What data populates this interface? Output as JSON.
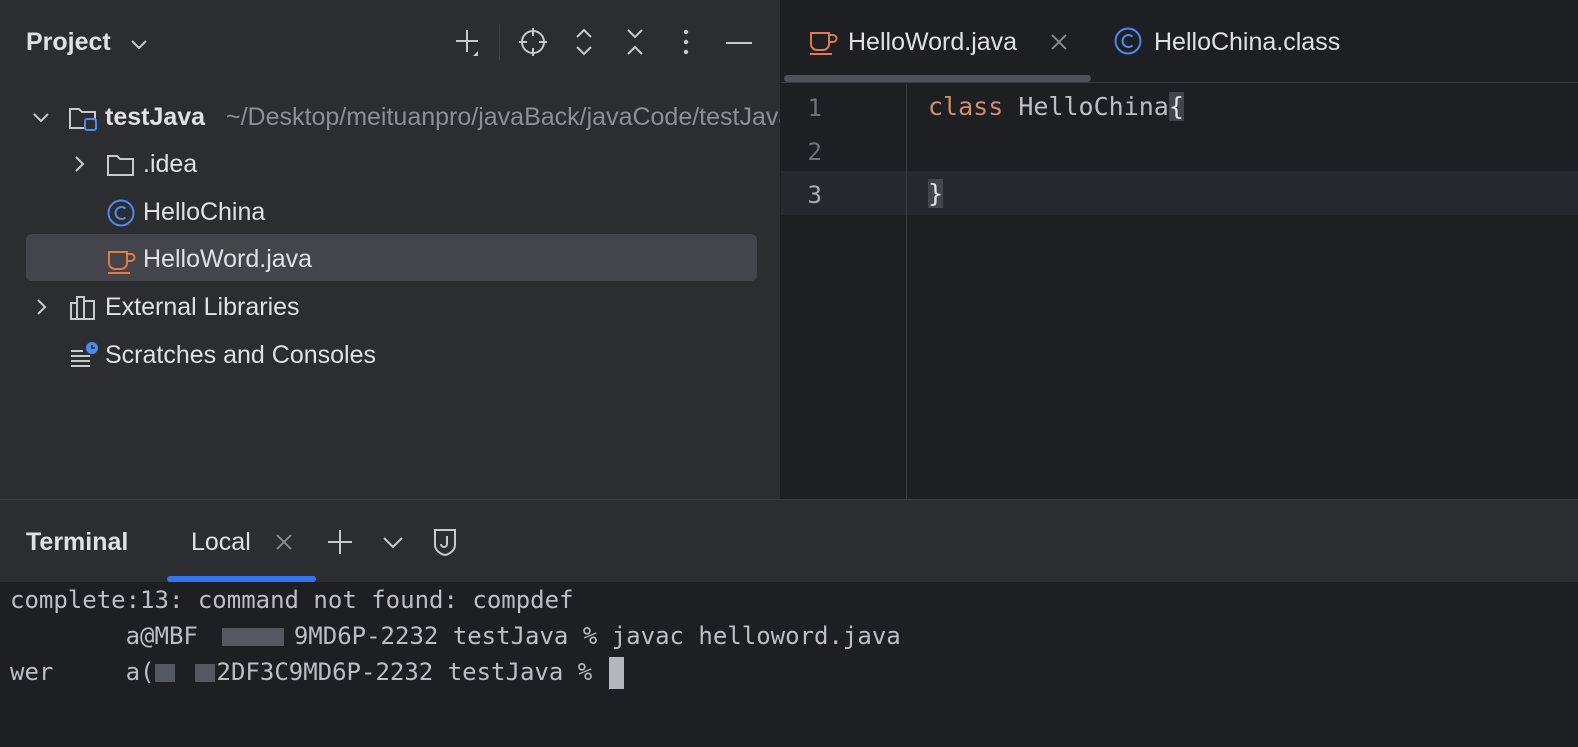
{
  "project_panel": {
    "title": "Project",
    "tree": {
      "root": {
        "name": "testJava",
        "path": "~/Desktop/meituanpro/javaBack/javaCode/testJava"
      },
      "items": [
        {
          "label": ".idea",
          "icon": "folder-icon"
        },
        {
          "label": "HelloChina",
          "icon": "class-icon"
        },
        {
          "label": "HelloWord.java",
          "icon": "java-file-icon",
          "selected": true
        },
        {
          "label": "External Libraries",
          "icon": "libraries-icon"
        },
        {
          "label": "Scratches and Consoles",
          "icon": "scratches-icon"
        }
      ]
    }
  },
  "editor": {
    "tabs": [
      {
        "label": "HelloWord.java",
        "icon": "java-file-icon",
        "active": true,
        "closable": true
      },
      {
        "label": "HelloChina.class",
        "icon": "class-icon",
        "active": false
      }
    ],
    "line_numbers": [
      "1",
      "2",
      "3"
    ],
    "current_line": 3,
    "code": {
      "line1_keyword": "class",
      "line1_name": " HelloChina",
      "line1_brace": "{",
      "line2": "",
      "line3_brace": "}"
    }
  },
  "terminal": {
    "title": "Terminal",
    "tab_label": "Local",
    "lines": {
      "l1": "complete:13: command not found: compdef",
      "l2_a": "        a@MBF",
      "l2_b": "9MD6P-2232 testJava % javac helloword.java",
      "l3_a": "wer",
      "l3_b": "     a(",
      "l3_c": "2DF3C9MD6P-2232 testJava % "
    }
  },
  "colors": {
    "accent": "#3574f0",
    "keyword": "#cf8e6d",
    "java_icon": "#e07a4c",
    "class_icon": "#4d8af0"
  }
}
